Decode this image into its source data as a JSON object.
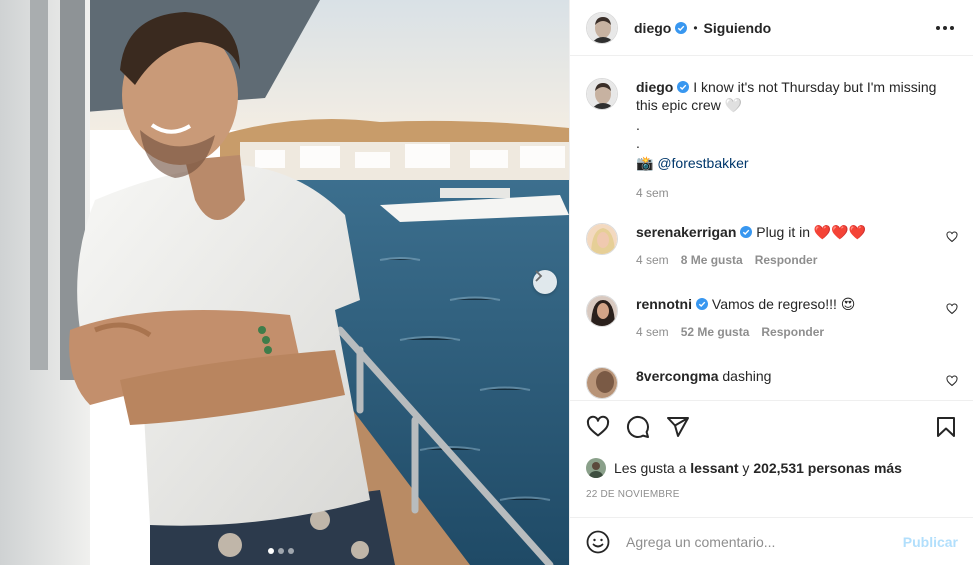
{
  "post": {
    "author": "diego",
    "follow_state": "Siguiendo",
    "bullet": "•"
  },
  "caption": {
    "username": "diego",
    "text": "I know it's not Thursday but I'm missing this epic crew 🤍",
    "line2": ".",
    "line3": ".",
    "credit_prefix": "📸",
    "mention": "@forestbakker",
    "time": "4 sem"
  },
  "comments": [
    {
      "username": "serenakerrigan",
      "verified": true,
      "text": "Plug it in ❤️❤️❤️",
      "time": "4 sem",
      "likes": "8 Me gusta",
      "reply": "Responder",
      "avatar_color": "#e8c9a8"
    },
    {
      "username": "rennotni",
      "verified": true,
      "text": "Vamos de regreso!!! 😍",
      "time": "4 sem",
      "likes": "52 Me gusta",
      "reply": "Responder",
      "avatar_color": "#4a3a35"
    },
    {
      "username": "8vercongma",
      "verified": false,
      "text": "dashing",
      "avatar_color": "#7a5a45"
    }
  ],
  "likes_line": {
    "prefix": "Les gusta a",
    "user": "lessant",
    "connector": "y",
    "count": "202,531 personas más"
  },
  "date": "22 DE NOVIEMBRE",
  "composer": {
    "placeholder": "Agrega un comentario...",
    "publish": "Publicar"
  },
  "carousel": {
    "total": 3,
    "active": 0
  },
  "colors": {
    "verified": "#3897f0",
    "link": "#00376b",
    "publish_disabled": "#b2dffc"
  },
  "icons": [
    "heart-icon",
    "comment-icon",
    "share-icon",
    "bookmark-icon",
    "emoji-icon",
    "more-icon",
    "chevron-right-icon"
  ]
}
